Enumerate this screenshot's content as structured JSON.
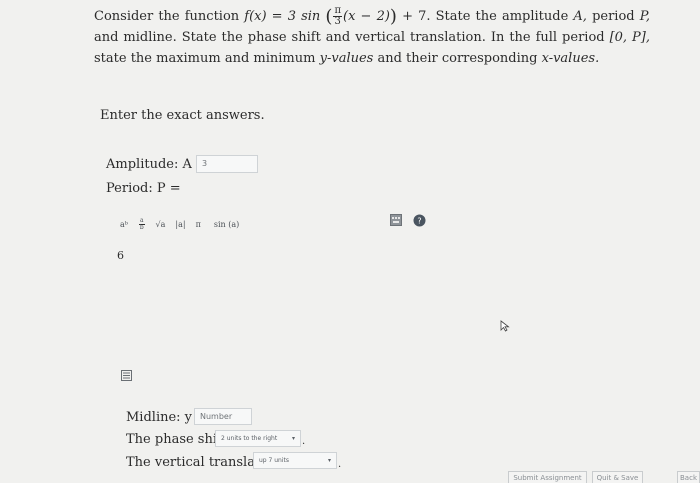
{
  "problem": {
    "part1": "Consider the function",
    "func_lhs": "f(x) = 3 sin",
    "frac_num": "π",
    "frac_den": "3",
    "func_inner": "(x − 2)",
    "func_tail": "+ 7.",
    "part2": "State the amplitude",
    "amp_sym": "A,",
    "part3": "period",
    "per_sym": "P,",
    "part4": "and midline. State the phase shift and vertical translation. In the full period",
    "interval": "[0, P],",
    "part5": "state the maximum and minimum",
    "yvals": "y-values",
    "part6": "and their corresponding",
    "xvals": "x-values."
  },
  "instructions": "Enter the exact answers.",
  "amplitude": {
    "label": "Amplitude: A =",
    "value": "3"
  },
  "period": {
    "label": "Period: P ="
  },
  "toolbar": {
    "power": "aᵇ",
    "fraction": "a/b",
    "sqrt": "√a",
    "abs": "|a|",
    "pi": "π",
    "sin": "sin (a)"
  },
  "editor_value": "6",
  "midline": {
    "label": "Midline: y =",
    "placeholder": "Number"
  },
  "phase_shift": {
    "label": "The phase shift is",
    "selected": "2 units to the right"
  },
  "vertical_translation": {
    "label": "The vertical translation is",
    "selected": "up 7 units"
  },
  "buttons": {
    "submit": "Submit Assignment",
    "quit": "Quit & Save",
    "back": "Back"
  },
  "colors": {
    "help_icon": "#4a5560",
    "background": "#f1f1ef"
  }
}
